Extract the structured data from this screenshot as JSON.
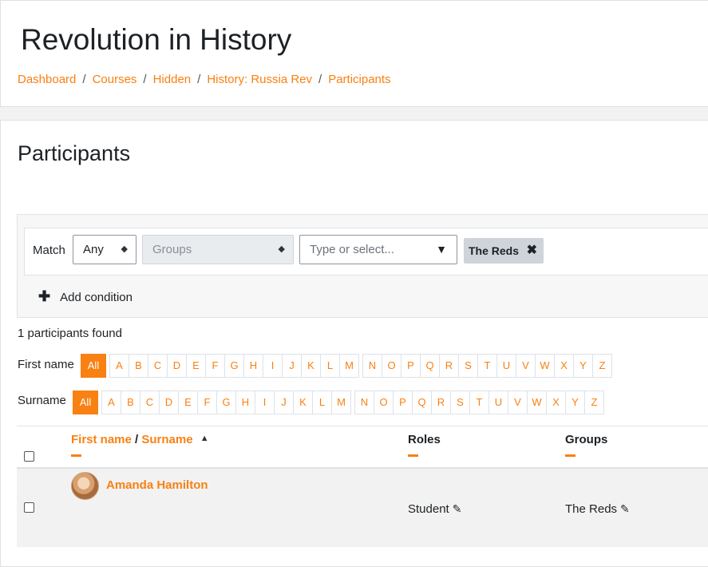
{
  "header": {
    "title": "Revolution in History",
    "breadcrumb": [
      "Dashboard",
      "Courses",
      "Hidden",
      "History: Russia Rev",
      "Participants"
    ],
    "separator": "/"
  },
  "main": {
    "title": "Participants",
    "filter": {
      "match_label": "Match",
      "match_value": "Any",
      "type_value": "Groups",
      "value_placeholder": "Type or select...",
      "chip_label": "The Reds",
      "chip_remove": "✖",
      "add_condition_label": "Add condition",
      "plus": "✚"
    },
    "found_text": "1 participants found",
    "first_name_label": "First name",
    "surname_label": "Surname",
    "all_label": "All",
    "letters_group1": [
      "A",
      "B",
      "C",
      "D",
      "E",
      "F",
      "G",
      "H",
      "I",
      "J",
      "K",
      "L",
      "M"
    ],
    "letters_group2": [
      "N",
      "O",
      "P",
      "Q",
      "R",
      "S",
      "T",
      "U",
      "V",
      "W",
      "X",
      "Y",
      "Z"
    ],
    "table": {
      "col_first_name": "First name",
      "col_sep": "/",
      "col_surname": "Surname",
      "col_roles": "Roles",
      "col_groups": "Groups",
      "rows": [
        {
          "name": "Amanda Hamilton",
          "role": "Student",
          "group": "The Reds"
        }
      ]
    }
  },
  "colors": {
    "accent": "#f98012",
    "chip_bg": "#ced4da"
  },
  "icons": {
    "sort": "triangle-up-icon",
    "edit": "pencil-icon",
    "remove": "close-icon",
    "add": "plus-icon"
  }
}
